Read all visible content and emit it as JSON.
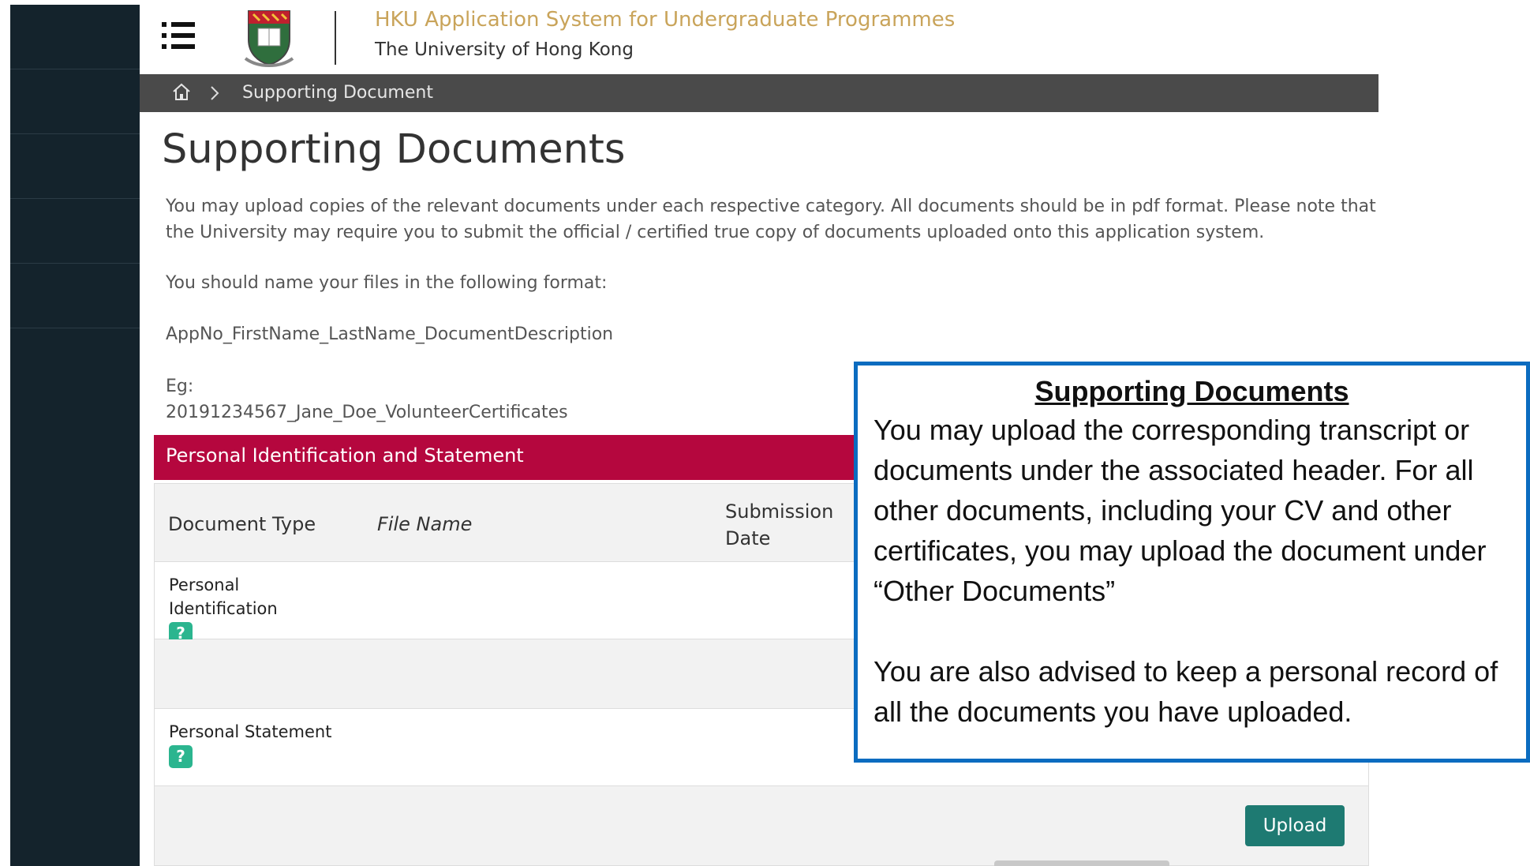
{
  "header": {
    "title": "HKU Application System for Undergraduate Programmes",
    "subtitle": "The University of Hong Kong"
  },
  "breadcrumb": {
    "current": "Supporting Document"
  },
  "page": {
    "title": "Supporting Documents",
    "intro": "You may upload copies of the relevant documents under each respective category. All documents should be in pdf format. Please note that the University may require you to submit the official / certified true copy of documents uploaded onto this application system.",
    "naming_instruction": "You should name your files in the following format:",
    "naming_format": "AppNo_FirstName_LastName_DocumentDescription",
    "example_label": "Eg:",
    "example_value": "20191234567_Jane_Doe_VolunteerCertificates"
  },
  "section": {
    "title": "Personal Identification and Statement",
    "columns": {
      "document_type": "Document Type",
      "file_name": "File Name",
      "submission_date": "Submission Date"
    },
    "rows": [
      {
        "label": "Personal Identification"
      },
      {
        "label": "Personal Statement"
      }
    ],
    "help_icon": "?",
    "upload_label": "Upload"
  },
  "callout": {
    "title": "Supporting Documents",
    "paragraph1": "You may upload the corresponding transcript or documents under the associated header. For all other documents, including your CV and other certificates, you may upload the document under “Other Documents”",
    "paragraph2": "You are also advised to keep a personal record of all the documents you have uploaded."
  },
  "colors": {
    "sidebar": "#14232c",
    "title_gold": "#c9a45a",
    "breadcrumb_bg": "#4a4a4a",
    "section_red": "#b5073e",
    "help_green": "#2bb58f",
    "upload_teal": "#1e7a72",
    "callout_border": "#0b6cc0"
  },
  "icons": {
    "menu": "hamburger-menu-icon",
    "logo": "hku-crest-logo",
    "home": "home-icon",
    "separator": "chevron-right-icon",
    "help": "help-question-icon"
  }
}
